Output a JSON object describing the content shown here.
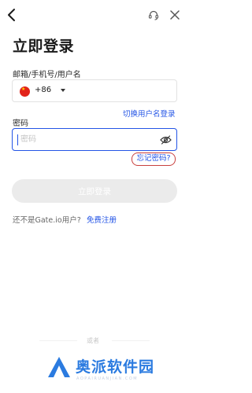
{
  "header": {
    "back_icon": "chevron-left-icon",
    "support_icon": "headset-icon",
    "close_icon": "close-icon"
  },
  "title": "立即登录",
  "account": {
    "label": "邮箱/手机号/用户名",
    "flag": "china-flag-icon",
    "country_code": "+86",
    "value": "",
    "switch_link": "切换用户名登录"
  },
  "password": {
    "label": "密码",
    "placeholder": "密码",
    "value": "",
    "toggle_icon": "eye-off-icon",
    "forgot_link": "忘记密码?"
  },
  "login_button": "立即登录",
  "register": {
    "prompt": "还不是Gate.io用户?",
    "link": "免费注册"
  },
  "divider_text": "或者",
  "watermark": {
    "text": "奥派软件园",
    "sub": "AOPAIRUANJIAN.COM"
  },
  "colors": {
    "accent": "#2354e6",
    "button_disabled": "#ebebeb",
    "highlight_box": "#c9403e",
    "watermark": "#2b7be0"
  }
}
